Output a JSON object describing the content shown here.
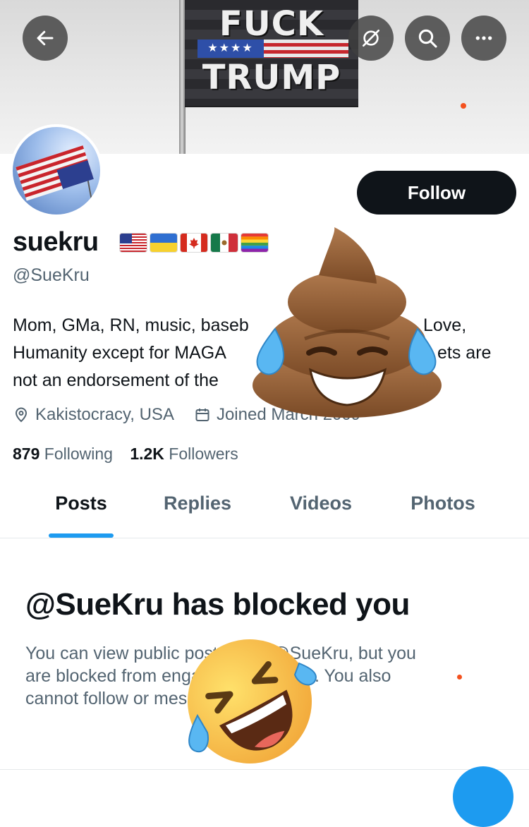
{
  "banner": {
    "flag_line_1": "FUCK",
    "flag_stars": "★★★★",
    "flag_line_2": "TRUMP"
  },
  "header_buttons": {
    "back_icon": "arrow-left-icon",
    "translate_icon": "translate-off-icon",
    "search_icon": "search-icon",
    "more_icon": "more-horizontal-icon"
  },
  "profile": {
    "avatar_icon": "upside-down-us-flag-avatar",
    "follow_label": "Follow",
    "display_name": "suekru",
    "name_flags": [
      "united-states-flag",
      "ukraine-flag",
      "canada-flag",
      "mexico-flag",
      "rainbow-flag"
    ],
    "handle": "@SueKru",
    "bio_lines": [
      "Mom, GMa, RN, music, baseb",
      "Love,",
      "Humanity except for MAGA",
      "ets are",
      "not an endorsement of the"
    ],
    "location": "Kakistocracy, USA",
    "joined": "Joined March 2009"
  },
  "stats": {
    "following_count": "879",
    "following_label": "Following",
    "followers_count": "1.2K",
    "followers_label": "Followers"
  },
  "tabs": [
    {
      "label": "Posts",
      "active": true
    },
    {
      "label": "Replies",
      "active": false
    },
    {
      "label": "Videos",
      "active": false
    },
    {
      "label": "Photos",
      "active": false
    }
  ],
  "blocked": {
    "title": "@SueKru has blocked you",
    "body_lines": [
      "You can view public posts from @SueKru, but you",
      "are blocked from engaging with them. You also",
      "cannot follow or message @SueKru."
    ]
  },
  "overlays": {
    "emoji_1": "pile-of-poo-emoji",
    "emoji_2": "rolling-on-floor-laughing-emoji"
  },
  "colors": {
    "accent": "#1d9bf0",
    "text_primary": "#0f1419",
    "text_secondary": "#536471",
    "follow_button_bg": "#0f1419"
  }
}
